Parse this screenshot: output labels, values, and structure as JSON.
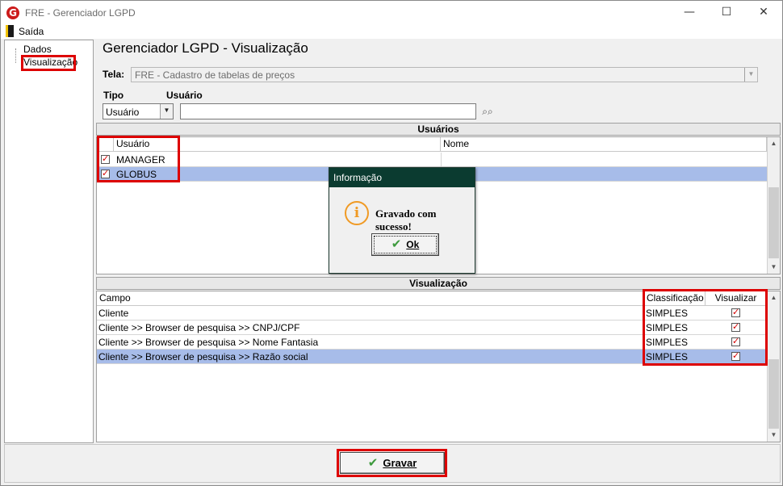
{
  "window": {
    "title": "FRE - Gerenciador LGPD",
    "logo_letter": "G",
    "minimize": "—",
    "maximize": "☐",
    "close": "✕"
  },
  "menu": {
    "exit_label": "Saída"
  },
  "tree": {
    "items": [
      "Dados",
      "Visualização"
    ],
    "selected": "Visualização"
  },
  "header": {
    "title": "Gerenciador LGPD - Visualização"
  },
  "form": {
    "tela_label": "Tela:",
    "tela_value": "FRE - Cadastro de tabelas de preços",
    "tipo_label": "Tipo",
    "usuario_label": "Usuário",
    "tipo_value": "Usuário",
    "usuario_value": "",
    "search_icon": "binoculars-icon"
  },
  "usuarios": {
    "section_title": "Usuários",
    "columns": [
      "Usuário",
      "Nome"
    ],
    "rows": [
      {
        "checked": true,
        "usuario": "MANAGER",
        "nome": ""
      },
      {
        "checked": true,
        "usuario": "GLOBUS",
        "nome": ""
      }
    ],
    "selected_row": 1
  },
  "visualizacao": {
    "section_title": "Visualização",
    "columns": [
      "Campo",
      "Classificação",
      "Visualizar"
    ],
    "rows": [
      {
        "campo": "Cliente",
        "classificacao": "SIMPLES",
        "visualizar": true
      },
      {
        "campo": "Cliente >> Browser de pesquisa >> CNPJ/CPF",
        "classificacao": "SIMPLES",
        "visualizar": true
      },
      {
        "campo": "Cliente >> Browser de pesquisa >> Nome Fantasia",
        "classificacao": "SIMPLES",
        "visualizar": true
      },
      {
        "campo": "Cliente >> Browser de pesquisa >> Razão social",
        "classificacao": "SIMPLES",
        "visualizar": true
      }
    ],
    "selected_row": 3
  },
  "dialog": {
    "title": "Informação",
    "message": "Gravado com sucesso!",
    "ok_label": "Ok",
    "icon": "info-icon"
  },
  "footer": {
    "save_label": "Gravar"
  },
  "colors": {
    "highlight": "#dd0000",
    "selected_row": "#a7bce9",
    "dialog_title_bg": "#0b3b30",
    "check_icon": "#3d9a3d"
  }
}
